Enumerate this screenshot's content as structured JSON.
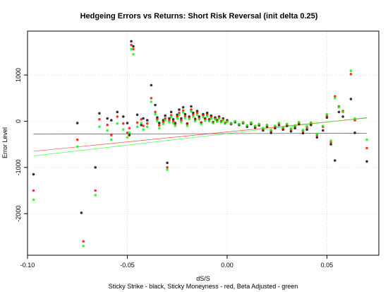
{
  "chart_data": {
    "type": "scatter",
    "title": "Hedgeing Errors vs Returns: Short Risk Reversal (init delta 0.25)",
    "xlabel": "dS/S",
    "ylabel": "Error Level",
    "caption": "Sticky Strike - black, Sticky Moneyness - red, Beta Adjusted - green",
    "xlim": [
      -0.1,
      0.076
    ],
    "ylim": [
      -2900,
      1950
    ],
    "x_ticks": [
      -0.1,
      -0.05,
      0.0,
      0.05
    ],
    "x_tick_labels": [
      "-0.10",
      "-0.05",
      "0.00",
      "0.05"
    ],
    "y_ticks": [
      -2000,
      -1000,
      0,
      1000
    ],
    "y_tick_labels": [
      "-2000",
      "-1000",
      "0",
      "1000"
    ],
    "grid": true,
    "series": [
      {
        "name": "Sticky Strike",
        "color": "#000000",
        "trend": [
          [
            -0.097,
            -280
          ],
          [
            0.07,
            -260
          ]
        ],
        "points": [
          [
            -0.097,
            -1150
          ],
          [
            -0.075,
            -40
          ],
          [
            -0.073,
            -1980
          ],
          [
            -0.066,
            -1000
          ],
          [
            -0.064,
            170
          ],
          [
            -0.06,
            60
          ],
          [
            -0.058,
            20
          ],
          [
            -0.055,
            200
          ],
          [
            -0.052,
            100
          ],
          [
            -0.05,
            -40
          ],
          [
            -0.049,
            -300
          ],
          [
            -0.048,
            1730
          ],
          [
            -0.047,
            1620
          ],
          [
            -0.045,
            140
          ],
          [
            -0.043,
            -80
          ],
          [
            -0.042,
            60
          ],
          [
            -0.04,
            20
          ],
          [
            -0.038,
            780
          ],
          [
            -0.036,
            350
          ],
          [
            -0.035,
            80
          ],
          [
            -0.034,
            -40
          ],
          [
            -0.032,
            20
          ],
          [
            -0.031,
            120
          ],
          [
            -0.03,
            -900
          ],
          [
            -0.029,
            60
          ],
          [
            -0.028,
            200
          ],
          [
            -0.027,
            40
          ],
          [
            -0.026,
            -40
          ],
          [
            -0.025,
            140
          ],
          [
            -0.024,
            250
          ],
          [
            -0.023,
            60
          ],
          [
            -0.022,
            300
          ],
          [
            -0.021,
            150
          ],
          [
            -0.02,
            -50
          ],
          [
            -0.019,
            100
          ],
          [
            -0.018,
            320
          ],
          [
            -0.017,
            180
          ],
          [
            -0.016,
            50
          ],
          [
            -0.015,
            220
          ],
          [
            -0.014,
            100
          ],
          [
            -0.013,
            -30
          ],
          [
            -0.012,
            150
          ],
          [
            -0.011,
            60
          ],
          [
            -0.01,
            180
          ],
          [
            -0.009,
            40
          ],
          [
            -0.008,
            120
          ],
          [
            -0.007,
            -20
          ],
          [
            -0.006,
            80
          ],
          [
            -0.005,
            20
          ],
          [
            -0.004,
            100
          ],
          [
            -0.003,
            0
          ],
          [
            -0.002,
            60
          ],
          [
            -0.001,
            -40
          ],
          [
            0.0,
            20
          ],
          [
            0.002,
            -60
          ],
          [
            0.004,
            -20
          ],
          [
            0.006,
            -80
          ],
          [
            0.008,
            -40
          ],
          [
            0.01,
            -120
          ],
          [
            0.012,
            -60
          ],
          [
            0.014,
            -140
          ],
          [
            0.016,
            -90
          ],
          [
            0.018,
            -200
          ],
          [
            0.02,
            -120
          ],
          [
            0.022,
            -250
          ],
          [
            0.024,
            -150
          ],
          [
            0.026,
            -80
          ],
          [
            0.028,
            -180
          ],
          [
            0.03,
            -100
          ],
          [
            0.032,
            -220
          ],
          [
            0.034,
            -150
          ],
          [
            0.036,
            -60
          ],
          [
            0.038,
            -260
          ],
          [
            0.04,
            -180
          ],
          [
            0.042,
            -80
          ],
          [
            0.045,
            -350
          ],
          [
            0.048,
            -200
          ],
          [
            0.05,
            80
          ],
          [
            0.052,
            -500
          ],
          [
            0.054,
            -850
          ],
          [
            0.056,
            200
          ],
          [
            0.058,
            100
          ],
          [
            0.062,
            480
          ],
          [
            0.064,
            -250
          ],
          [
            0.07,
            -870
          ]
        ]
      },
      {
        "name": "Sticky Moneyness",
        "color": "#ff0000",
        "trend": [
          [
            -0.097,
            -650
          ],
          [
            0.07,
            70
          ]
        ],
        "points": [
          [
            -0.097,
            -1500
          ],
          [
            -0.075,
            -400
          ],
          [
            -0.072,
            -2600
          ],
          [
            -0.066,
            -1500
          ],
          [
            -0.064,
            40
          ],
          [
            -0.06,
            -80
          ],
          [
            -0.058,
            -300
          ],
          [
            -0.055,
            100
          ],
          [
            -0.052,
            -50
          ],
          [
            -0.05,
            -250
          ],
          [
            -0.049,
            -150
          ],
          [
            -0.048,
            1650
          ],
          [
            -0.047,
            1560
          ],
          [
            -0.045,
            -30
          ],
          [
            -0.043,
            40
          ],
          [
            -0.042,
            -100
          ],
          [
            -0.04,
            -50
          ],
          [
            -0.038,
            500
          ],
          [
            -0.036,
            200
          ],
          [
            -0.035,
            40
          ],
          [
            -0.034,
            -90
          ],
          [
            -0.032,
            -20
          ],
          [
            -0.031,
            60
          ],
          [
            -0.03,
            -1000
          ],
          [
            -0.029,
            20
          ],
          [
            -0.028,
            130
          ],
          [
            -0.027,
            0
          ],
          [
            -0.026,
            -60
          ],
          [
            -0.025,
            100
          ],
          [
            -0.024,
            180
          ],
          [
            -0.023,
            20
          ],
          [
            -0.022,
            230
          ],
          [
            -0.021,
            110
          ],
          [
            -0.02,
            -60
          ],
          [
            -0.019,
            80
          ],
          [
            -0.018,
            250
          ],
          [
            -0.017,
            140
          ],
          [
            -0.016,
            30
          ],
          [
            -0.015,
            180
          ],
          [
            -0.014,
            70
          ],
          [
            -0.013,
            -30
          ],
          [
            -0.012,
            120
          ],
          [
            -0.011,
            40
          ],
          [
            -0.01,
            140
          ],
          [
            -0.009,
            30
          ],
          [
            -0.008,
            90
          ],
          [
            -0.007,
            -20
          ],
          [
            -0.006,
            60
          ],
          [
            -0.005,
            10
          ],
          [
            -0.004,
            80
          ],
          [
            -0.003,
            0
          ],
          [
            -0.002,
            40
          ],
          [
            -0.001,
            -40
          ],
          [
            0.0,
            0
          ],
          [
            0.002,
            -50
          ],
          [
            0.004,
            -10
          ],
          [
            0.006,
            -70
          ],
          [
            0.008,
            -30
          ],
          [
            0.01,
            -100
          ],
          [
            0.012,
            -40
          ],
          [
            0.014,
            -110
          ],
          [
            0.016,
            -70
          ],
          [
            0.018,
            -170
          ],
          [
            0.02,
            -90
          ],
          [
            0.022,
            -210
          ],
          [
            0.024,
            -120
          ],
          [
            0.026,
            -50
          ],
          [
            0.028,
            -150
          ],
          [
            0.03,
            -70
          ],
          [
            0.032,
            -180
          ],
          [
            0.034,
            -110
          ],
          [
            0.036,
            -30
          ],
          [
            0.038,
            -210
          ],
          [
            0.04,
            -130
          ],
          [
            0.042,
            -40
          ],
          [
            0.045,
            -300
          ],
          [
            0.048,
            -120
          ],
          [
            0.05,
            120
          ],
          [
            0.052,
            -450
          ],
          [
            0.054,
            540
          ],
          [
            0.056,
            320
          ],
          [
            0.058,
            220
          ],
          [
            0.062,
            1020
          ],
          [
            0.064,
            20
          ],
          [
            0.07,
            -580
          ]
        ]
      },
      {
        "name": "Beta Adjusted",
        "color": "#00ff00",
        "trend": [
          [
            -0.097,
            -750
          ],
          [
            0.07,
            80
          ]
        ],
        "points": [
          [
            -0.097,
            -1700
          ],
          [
            -0.075,
            -550
          ],
          [
            -0.072,
            -2700
          ],
          [
            -0.066,
            -1600
          ],
          [
            -0.064,
            -120
          ],
          [
            -0.06,
            -200
          ],
          [
            -0.058,
            -400
          ],
          [
            -0.055,
            -50
          ],
          [
            -0.052,
            -180
          ],
          [
            -0.05,
            -350
          ],
          [
            -0.049,
            -250
          ],
          [
            -0.048,
            1560
          ],
          [
            -0.047,
            1450
          ],
          [
            -0.045,
            -120
          ],
          [
            -0.043,
            -40
          ],
          [
            -0.042,
            -180
          ],
          [
            -0.04,
            -120
          ],
          [
            -0.038,
            420
          ],
          [
            -0.036,
            150
          ],
          [
            -0.035,
            0
          ],
          [
            -0.034,
            -150
          ],
          [
            -0.032,
            -60
          ],
          [
            -0.031,
            20
          ],
          [
            -0.03,
            -1050
          ],
          [
            -0.029,
            -20
          ],
          [
            -0.028,
            90
          ],
          [
            -0.027,
            -40
          ],
          [
            -0.026,
            -100
          ],
          [
            -0.025,
            60
          ],
          [
            -0.024,
            140
          ],
          [
            -0.023,
            -20
          ],
          [
            -0.022,
            190
          ],
          [
            -0.021,
            70
          ],
          [
            -0.02,
            -100
          ],
          [
            -0.019,
            50
          ],
          [
            -0.018,
            210
          ],
          [
            -0.017,
            100
          ],
          [
            -0.016,
            0
          ],
          [
            -0.015,
            140
          ],
          [
            -0.014,
            40
          ],
          [
            -0.013,
            -60
          ],
          [
            -0.012,
            90
          ],
          [
            -0.011,
            10
          ],
          [
            -0.01,
            110
          ],
          [
            -0.009,
            0
          ],
          [
            -0.008,
            60
          ],
          [
            -0.007,
            -40
          ],
          [
            -0.006,
            40
          ],
          [
            -0.005,
            -10
          ],
          [
            -0.004,
            60
          ],
          [
            -0.003,
            -20
          ],
          [
            -0.002,
            20
          ],
          [
            -0.001,
            -50
          ],
          [
            0.0,
            -10
          ],
          [
            0.002,
            -40
          ],
          [
            0.004,
            0
          ],
          [
            0.006,
            -60
          ],
          [
            0.008,
            -20
          ],
          [
            0.01,
            -90
          ],
          [
            0.012,
            -30
          ],
          [
            0.014,
            -100
          ],
          [
            0.016,
            -60
          ],
          [
            0.018,
            -150
          ],
          [
            0.02,
            -80
          ],
          [
            0.022,
            -190
          ],
          [
            0.024,
            -100
          ],
          [
            0.026,
            -40
          ],
          [
            0.028,
            -130
          ],
          [
            0.03,
            -60
          ],
          [
            0.032,
            -160
          ],
          [
            0.034,
            -90
          ],
          [
            0.036,
            -20
          ],
          [
            0.038,
            -190
          ],
          [
            0.04,
            -110
          ],
          [
            0.042,
            -30
          ],
          [
            0.045,
            -280
          ],
          [
            0.048,
            -100
          ],
          [
            0.05,
            150
          ],
          [
            0.052,
            -420
          ],
          [
            0.054,
            500
          ],
          [
            0.056,
            300
          ],
          [
            0.058,
            200
          ],
          [
            0.062,
            1090
          ],
          [
            0.064,
            60
          ],
          [
            0.07,
            -400
          ]
        ]
      }
    ]
  }
}
